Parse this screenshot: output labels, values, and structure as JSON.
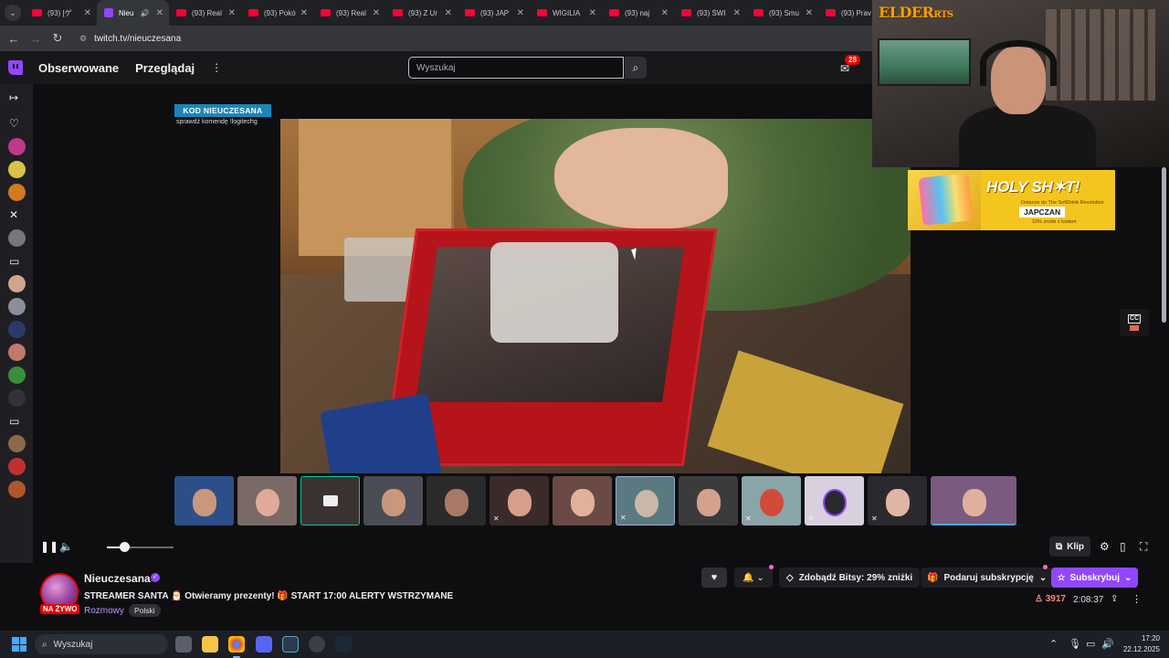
{
  "browser": {
    "tabs": [
      {
        "title": "(93) [ゲ",
        "favicon": "youtube",
        "active": false
      },
      {
        "title": "Nieu",
        "favicon": "twitch",
        "active": true,
        "audio": true
      },
      {
        "title": "(93) Real",
        "favicon": "youtube",
        "active": false
      },
      {
        "title": "(93) Pokó",
        "favicon": "youtube",
        "active": false
      },
      {
        "title": "(93) Real",
        "favicon": "youtube",
        "active": false
      },
      {
        "title": "(93) Z Ur",
        "favicon": "youtube",
        "active": false
      },
      {
        "title": "(93) JAP",
        "favicon": "youtube",
        "active": false
      },
      {
        "title": "WIGILIA",
        "favicon": "youtube",
        "active": false
      },
      {
        "title": "(93) naj",
        "favicon": "youtube",
        "active": false
      },
      {
        "title": "(93) ŚWI",
        "favicon": "youtube",
        "active": false
      },
      {
        "title": "(93) Smu",
        "favicon": "youtube",
        "active": false
      },
      {
        "title": "(93) Prav",
        "favicon": "youtube",
        "active": false
      }
    ],
    "url": "twitch.tv/nieuczesana"
  },
  "topnav": {
    "following": "Obserwowane",
    "browse": "Przeglądaj",
    "search_placeholder": "Wyszukaj",
    "inbox_count": "28"
  },
  "overlay": {
    "kod_tag": "KOD NIEUCZESANA",
    "kod_sub": "sprawdź komendę !logitechg",
    "webcam_brand": "ELDER",
    "webcam_brand_small": "RTS"
  },
  "promo": {
    "title": "HOLY SH✶T!",
    "sub": "Dotarcie do The SoftDrink Revolution",
    "code": "JAPCZAN",
    "discount": "10% zniżki z kodem"
  },
  "player": {
    "clip_label": "Klip"
  },
  "channel": {
    "streamer_name": "Nieuczesana",
    "live_label": "NA ŻYWO",
    "stream_title": "STREAMER SANTA 🎅 Otwieramy prezenty! 🎁 START 17:00 ALERTY WSTRZYMANE",
    "category": "Rozmowy",
    "language_tag": "Polski",
    "bits_label": "Zdobądź Bitsy: 29% zniżki",
    "gift_sub_label": "Podaruj subskrypcję",
    "subscribe_label": "Subskrybuj",
    "viewers": "3917",
    "uptime": "2:08:37"
  },
  "taskbar": {
    "search_placeholder": "Wyszukaj",
    "time": "17:20",
    "date": "22.12.2025"
  },
  "colors": {
    "twitch_purple": "#9146ff",
    "live_red": "#eb0400",
    "youtube_red": "#ff0033",
    "promo_yellow": "#f4c51c",
    "kod_blue": "#1b86b8"
  },
  "player_volume": 0.26
}
